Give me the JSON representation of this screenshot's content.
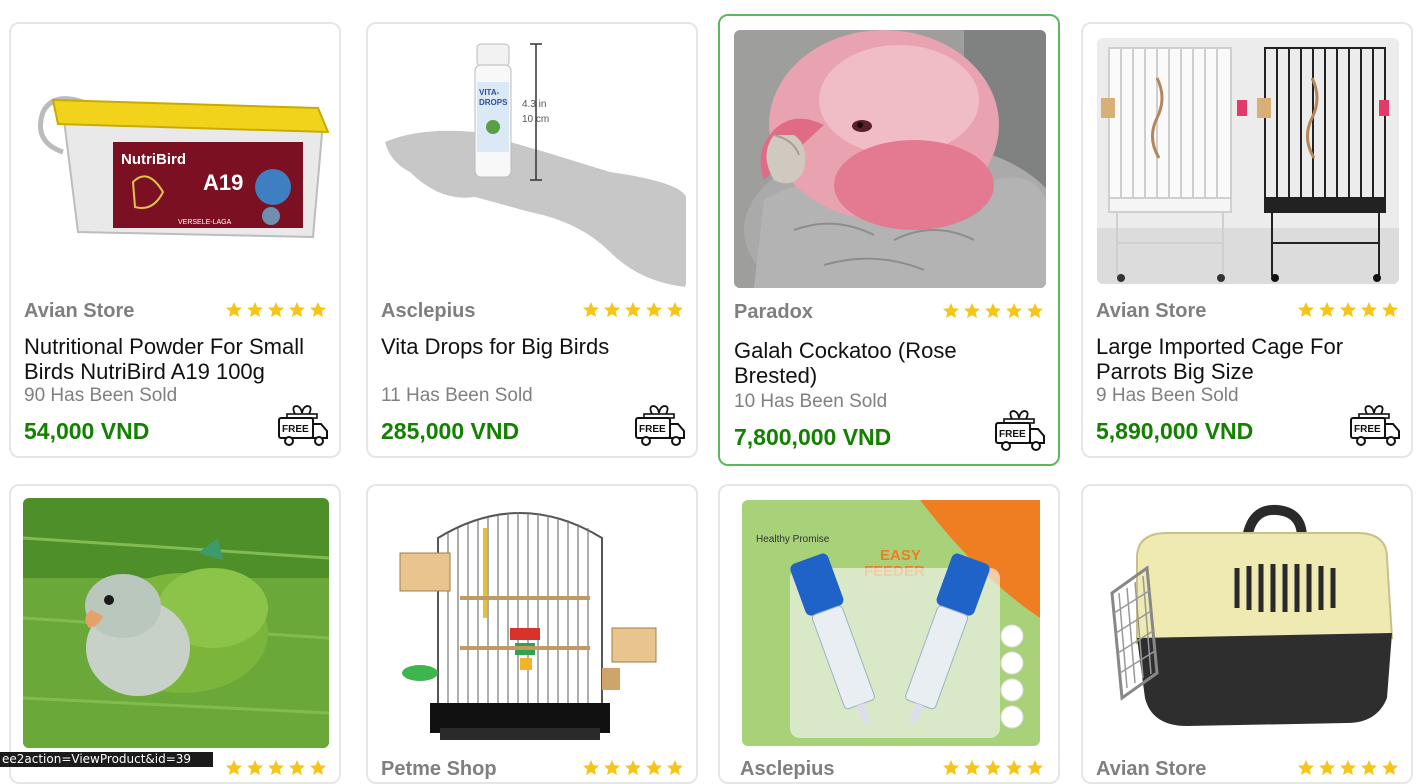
{
  "products": [
    {
      "seller": "Avian Store",
      "name": "Nutritional Powder For Small Birds NutriBird A19 100g",
      "sold": "90 Has Been Sold",
      "price": "54,000 VND",
      "rating": 5,
      "image": "nutribird-tub-image"
    },
    {
      "seller": "Asclepius",
      "name": "Vita Drops for Big Birds",
      "sold": "11 Has Been Sold",
      "price": "285,000 VND",
      "rating": 5,
      "image": "vita-drops-bottle-image"
    },
    {
      "seller": "Paradox",
      "name": "Galah Cockatoo (Rose Brested)",
      "sold": "10 Has Been Sold",
      "price": "7,800,000 VND",
      "rating": 5,
      "image": "galah-cockatoo-image"
    },
    {
      "seller": "Avian Store",
      "name": "Large Imported Cage For Parrots Big Size",
      "sold": "9 Has Been Sold",
      "price": "5,890,000 VND",
      "rating": 5,
      "image": "parrot-cages-image"
    },
    {
      "seller": "",
      "name": "",
      "sold": "",
      "price": "",
      "rating": 5,
      "image": "green-parakeet-image"
    },
    {
      "seller": "Petme Shop",
      "name": "",
      "sold": "",
      "price": "",
      "rating": 5,
      "image": "bird-cage-image"
    },
    {
      "seller": "Asclepius",
      "name": "",
      "sold": "",
      "price": "",
      "rating": 5,
      "image": "easy-feeder-syringe-image"
    },
    {
      "seller": "Avian Store",
      "name": "",
      "sold": "",
      "price": "",
      "rating": 5,
      "image": "pet-carrier-image"
    }
  ],
  "free_ship_label": "FREE",
  "packaging": {
    "nutribird_brand": "NutriBird",
    "nutribird_code": "A19",
    "nutribird_maker": "VERSELE-LAGA",
    "vita_label_1": "VITA-",
    "vita_label_2": "DROPS",
    "vita_size_in": "4.3 in",
    "vita_size_cm": "10 cm",
    "feeder_brand": "Healthy Promise",
    "feeder_title_1": "EASY",
    "feeder_title_2": "FEEDER"
  },
  "status_bar_url": "ee2action=ViewProduct&id=39",
  "colors": {
    "price": "#138000",
    "star": "#f5c518",
    "seller": "#7f7f7f",
    "hover_border": "#5cb85c"
  }
}
